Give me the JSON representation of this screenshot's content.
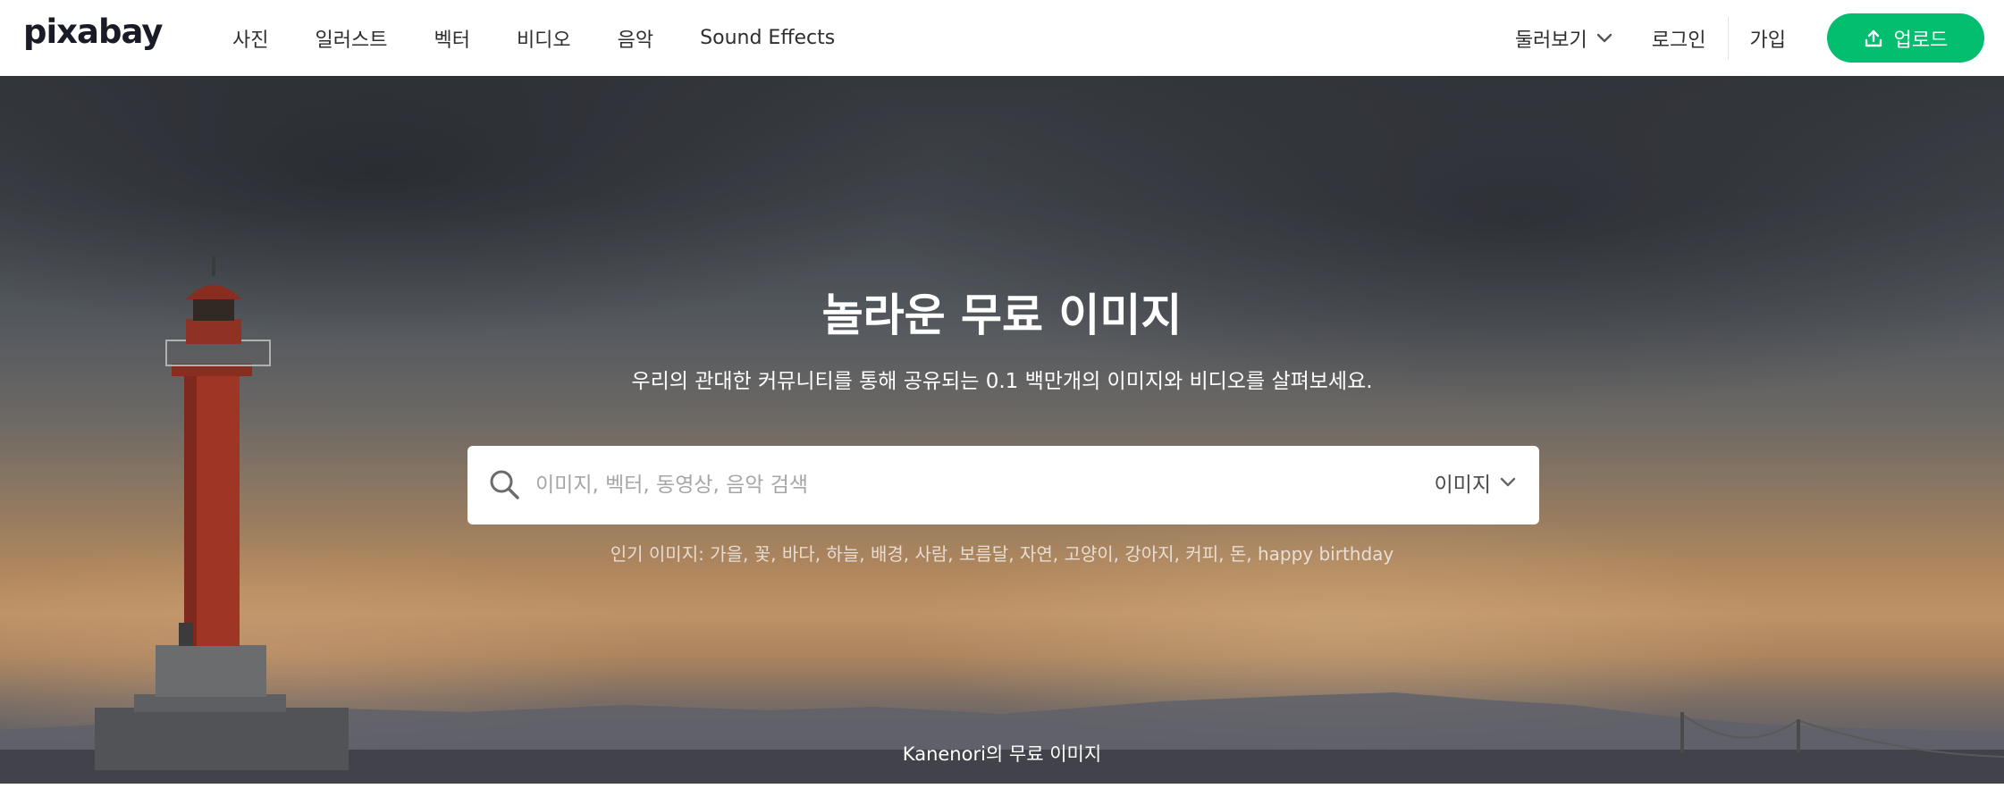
{
  "header": {
    "logo": "pixabay",
    "nav": [
      "사진",
      "일러스트",
      "벡터",
      "비디오",
      "음악",
      "Sound Effects"
    ],
    "explore_label": "둘러보기",
    "login_label": "로그인",
    "join_label": "가입",
    "upload_label": "업로드",
    "upload_color": "#02be6e"
  },
  "hero": {
    "title": "놀라운 무료 이미지",
    "subtitle": "우리의 관대한 커뮤니티를 통해 공유되는 0.1 백만개의 이미지와 비디오를 살펴보세요.",
    "search": {
      "placeholder": "이미지, 벡터, 동영상, 음악 검색",
      "value": "",
      "type_label": "이미지",
      "icon": "search-icon"
    },
    "popular_label": "인기 이미지:",
    "popular_tags": [
      "가을",
      "꽃",
      "바다",
      "하늘",
      "배경",
      "사람",
      "보름달",
      "자연",
      "고양이",
      "강아지",
      "커피",
      "돈",
      "happy birthday"
    ],
    "credit": "Kanenori의 무료 이미지"
  }
}
